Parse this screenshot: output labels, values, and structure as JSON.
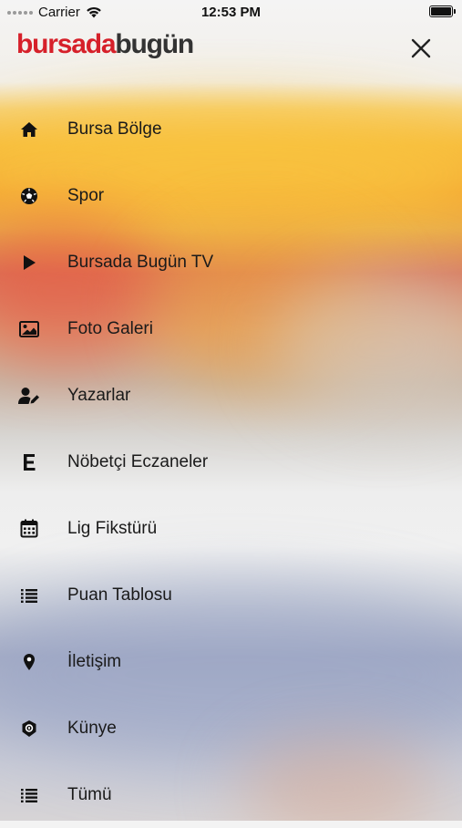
{
  "status_bar": {
    "carrier": "Carrier",
    "time": "12:53 PM"
  },
  "header": {
    "logo_part1": "bursada",
    "logo_part2": "bugün"
  },
  "menu": {
    "items": [
      {
        "label": "Bursa Bölge",
        "icon": "home-icon"
      },
      {
        "label": "Spor",
        "icon": "soccer-ball-icon"
      },
      {
        "label": "Bursada Bugün TV",
        "icon": "play-icon"
      },
      {
        "label": "Foto Galeri",
        "icon": "image-icon"
      },
      {
        "label": "Yazarlar",
        "icon": "user-edit-icon"
      },
      {
        "label": "Nöbetçi Eczaneler",
        "icon": "letter-e-icon"
      },
      {
        "label": "Lig Fikstürü",
        "icon": "calendar-icon"
      },
      {
        "label": "Puan Tablosu",
        "icon": "list-icon"
      },
      {
        "label": "İletişim",
        "icon": "map-pin-icon"
      },
      {
        "label": "Künye",
        "icon": "badge-icon"
      },
      {
        "label": "Tümü",
        "icon": "list-icon"
      }
    ]
  },
  "colors": {
    "brand_red": "#d6202a",
    "brand_dark": "#333333"
  }
}
